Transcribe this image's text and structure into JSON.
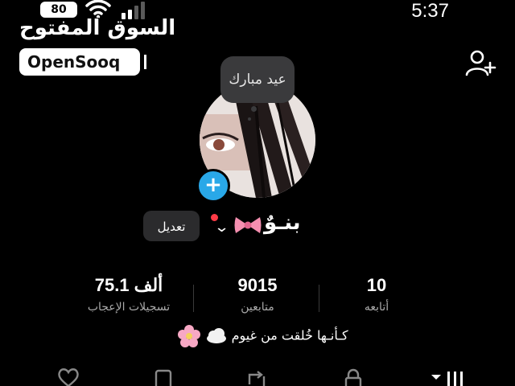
{
  "status_bar": {
    "battery": "80",
    "time": "5:37",
    "icons": [
      "battery-icon",
      "wifi-icon",
      "cellular-signal-icon"
    ]
  },
  "watermark": {
    "arabic": "السوق المفتوح",
    "english": "OpenSooq"
  },
  "header": {
    "add_user_icon": "add-user-icon"
  },
  "profile": {
    "story_note": "عيد مبارك",
    "edit_label": "تعديل",
    "username": "بنـوٌ",
    "bio": "كـأنـها خُلقت من غيوم",
    "stats": [
      {
        "value": "10",
        "label": "أتابعه"
      },
      {
        "value": "9015",
        "label": "متابعين"
      },
      {
        "value": "75.1 ألف",
        "label": "تسجيلات الإعجاب"
      }
    ]
  },
  "tabs": [
    "heart-icon",
    "bookmark-icon",
    "repost-icon",
    "lock-icon",
    "grid-icon"
  ],
  "colors": {
    "background": "#000000",
    "accent_blue": "#29a8e8",
    "notification_red": "#ff3b46",
    "chip_gray": "#2b2b2d"
  }
}
